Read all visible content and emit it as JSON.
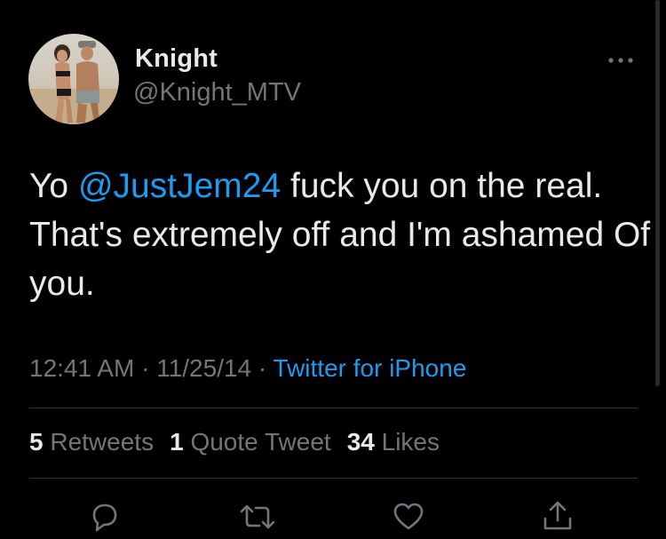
{
  "tweet": {
    "display_name": "Knight",
    "handle": "@Knight_MTV",
    "text_prefix": "Yo ",
    "mention": "@JustJem24",
    "text_suffix": " fuck you on the real. That's extremely off and I'm ashamed Of you.",
    "time": "12:41 AM",
    "date": "11/25/14",
    "source": "Twitter for iPhone",
    "separator": "·"
  },
  "stats": {
    "retweets_count": "5",
    "retweets_label": "Retweets",
    "quotes_count": "1",
    "quotes_label": "Quote Tweet",
    "likes_count": "34",
    "likes_label": "Likes"
  },
  "icons": {
    "more": "more-horizontal-icon",
    "reply": "reply-icon",
    "retweet": "retweet-icon",
    "like": "heart-icon",
    "share": "share-icon"
  },
  "colors": {
    "background": "#000000",
    "text_primary": "#e7e9ea",
    "text_secondary": "#71767b",
    "accent": "#1d9bf0",
    "divider": "#2f3336"
  }
}
